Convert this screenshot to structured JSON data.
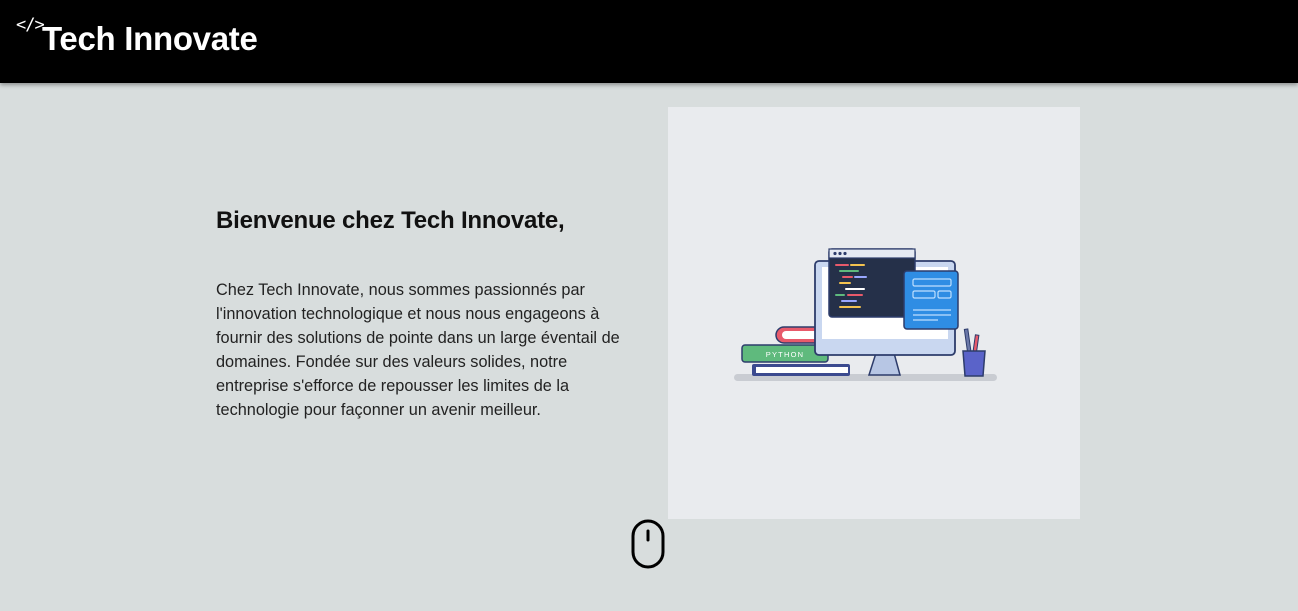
{
  "header": {
    "logo_glyph": "</>",
    "brand_name": "Tech Innovate",
    "background_color": "#000000"
  },
  "hero": {
    "title": "Bienvenue chez Tech Innovate,",
    "paragraph": "Chez Tech Innovate, nous sommes passionnés par l'innovation technologique et nous nous engageons à fournir des solutions de pointe dans un large éventail de domaines. Fondée sur des valeurs solides, notre entreprise s'efforce de repousser les limites de la technologie pour façonner un avenir meilleur.",
    "book_label": "PYTHON"
  },
  "icons": {
    "logo": "code-brackets-icon",
    "scroll": "mouse-scroll-icon"
  },
  "colors": {
    "page_background": "#d8dddd",
    "illustration_background": "#e9ebee",
    "accent_blue": "#2f8de4",
    "accent_green": "#5fba7d"
  }
}
